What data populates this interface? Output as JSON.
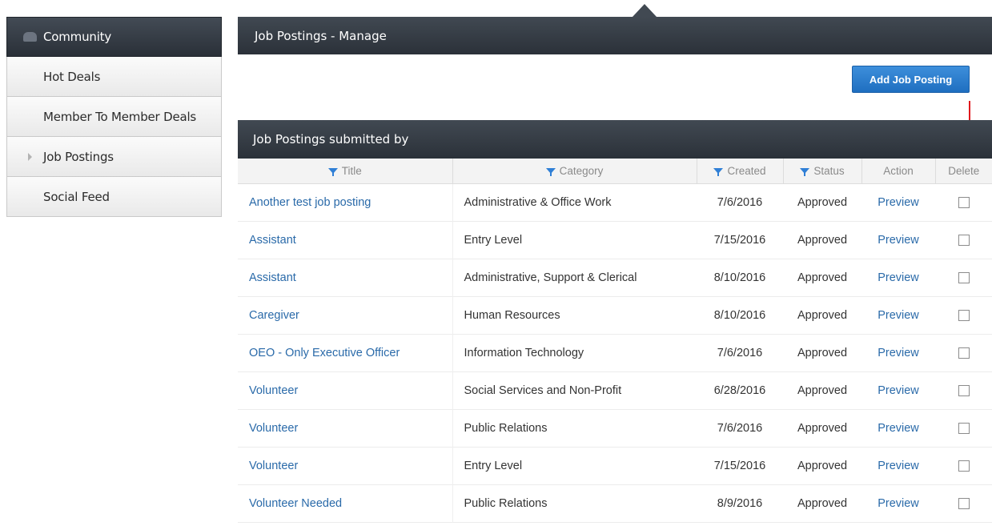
{
  "sidebar": {
    "items": [
      {
        "label": "Community"
      },
      {
        "label": "Hot Deals"
      },
      {
        "label": "Member To Member Deals"
      },
      {
        "label": "Job Postings"
      },
      {
        "label": "Social Feed"
      }
    ]
  },
  "main": {
    "title": "Job Postings - Manage",
    "add_button_label": "Add Job Posting"
  },
  "panel": {
    "title": "Job Postings submitted by",
    "columns": [
      "Title",
      "Category",
      "Created",
      "Status",
      "Action",
      "Delete"
    ],
    "rows": [
      {
        "title": "Another test job posting",
        "category": "Administrative & Office Work",
        "created": "7/6/2016",
        "status": "Approved",
        "action": "Preview"
      },
      {
        "title": "Assistant",
        "category": "Entry Level",
        "created": "7/15/2016",
        "status": "Approved",
        "action": "Preview"
      },
      {
        "title": "Assistant",
        "category": "Administrative, Support & Clerical",
        "created": "8/10/2016",
        "status": "Approved",
        "action": "Preview"
      },
      {
        "title": "Caregiver",
        "category": "Human Resources",
        "created": "8/10/2016",
        "status": "Approved",
        "action": "Preview"
      },
      {
        "title": "OEO - Only Executive Officer",
        "category": "Information Technology",
        "created": "7/6/2016",
        "status": "Approved",
        "action": "Preview"
      },
      {
        "title": "Volunteer",
        "category": "Social Services and Non-Profit",
        "created": "6/28/2016",
        "status": "Approved",
        "action": "Preview"
      },
      {
        "title": "Volunteer",
        "category": "Public Relations",
        "created": "7/6/2016",
        "status": "Approved",
        "action": "Preview"
      },
      {
        "title": "Volunteer",
        "category": "Entry Level",
        "created": "7/15/2016",
        "status": "Approved",
        "action": "Preview"
      },
      {
        "title": "Volunteer Needed",
        "category": "Public Relations",
        "created": "8/9/2016",
        "status": "Approved",
        "action": "Preview"
      }
    ]
  },
  "colors": {
    "header_dark": "#2b3139",
    "link": "#2a6aa9",
    "button": "#1f6fc0",
    "annotation_arrow": "#e0191d"
  }
}
